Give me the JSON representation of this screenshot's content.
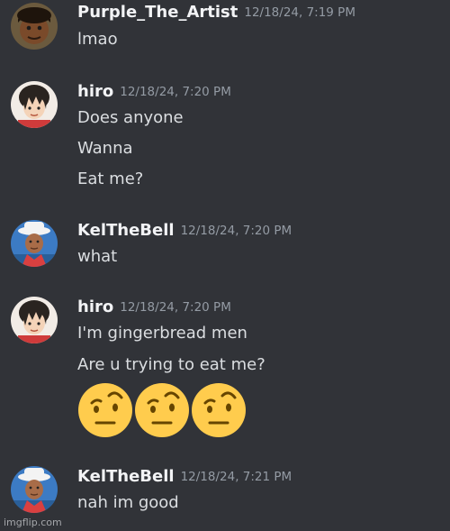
{
  "messages": [
    {
      "username": "Purple_The_Artist",
      "timestamp": "12/18/24, 7:19 PM",
      "lines": [
        "lmao"
      ]
    },
    {
      "username": "hiro",
      "timestamp": "12/18/24, 7:20 PM",
      "lines": [
        "Does anyone",
        "Wanna",
        "Eat me?"
      ]
    },
    {
      "username": "KelTheBell",
      "timestamp": "12/18/24, 7:20 PM",
      "lines": [
        "what"
      ]
    },
    {
      "username": "hiro",
      "timestamp": "12/18/24, 7:20 PM",
      "lines": [
        "I'm gingerbread men",
        "Are u trying to eat me?"
      ],
      "emojis": [
        "raised-eyebrow-emoji",
        "raised-eyebrow-emoji",
        "raised-eyebrow-emoji"
      ]
    },
    {
      "username": "KelTheBell",
      "timestamp": "12/18/24, 7:21 PM",
      "lines": [
        "nah im good"
      ]
    }
  ],
  "watermark": "imgflip.com",
  "colors": {
    "background": "#313338",
    "username": "#f2f3f5",
    "timestamp": "#949ba4",
    "message_text": "#dbdee1",
    "emoji_face": "#ffcc4d"
  }
}
